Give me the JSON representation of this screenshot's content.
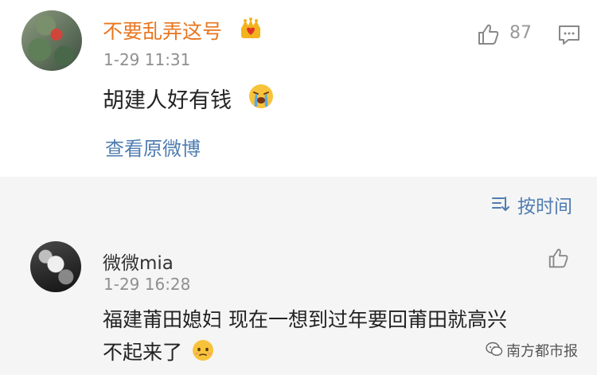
{
  "original_post_comment": {
    "username": "不要乱弄这号",
    "badge_icon": "crown-icon",
    "time": "1-29 11:31",
    "text": "胡建人好有钱",
    "emoji": "crying-face-icon",
    "view_original_label": "查看原微博",
    "like_count": "87",
    "accent_color": "#e8761f"
  },
  "sort": {
    "label": "按时间",
    "icon": "sort-icon"
  },
  "reply_comment": {
    "username": "微微mia",
    "time": "1-29 16:28",
    "text_line1": "福建莆田媳妇 现在一想到过年要回莆田就高兴",
    "text_line2": "不起来了",
    "emoji": "sweating-face-icon"
  },
  "watermark": {
    "label": "南方都市报",
    "icon": "wechat-icon"
  },
  "colors": {
    "link": "#4f7db1",
    "meta": "#8f8f8f",
    "background_alt": "#f5f5f5"
  }
}
